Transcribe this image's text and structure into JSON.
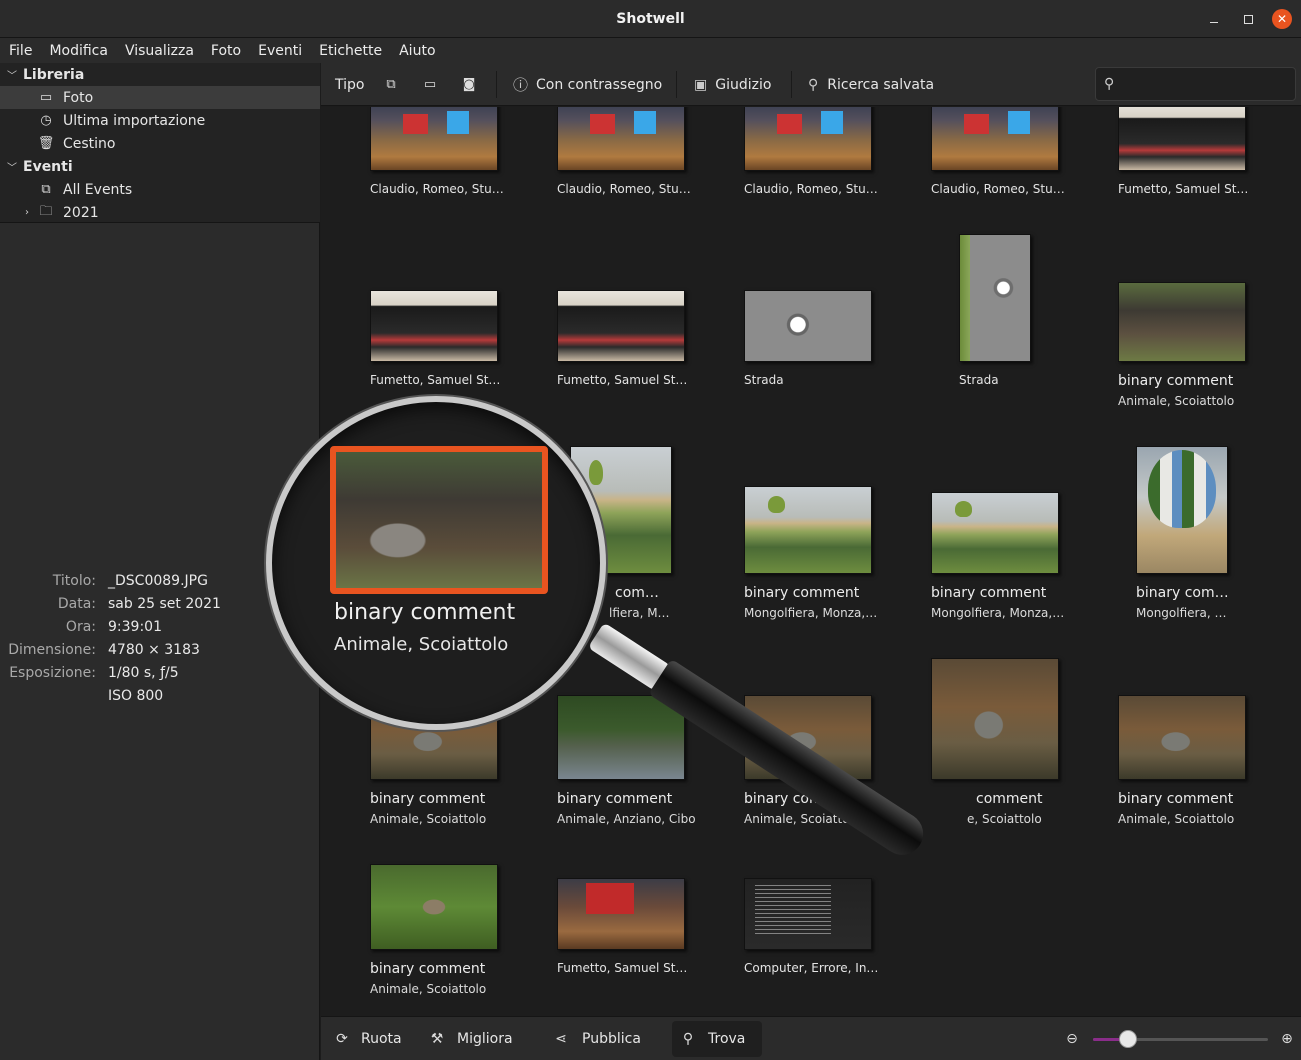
{
  "window": {
    "title": "Shotwell"
  },
  "menu": [
    "File",
    "Modifica",
    "Visualizza",
    "Foto",
    "Eventi",
    "Etichette",
    "Aiuto"
  ],
  "sidebar": {
    "library_label": "Libreria",
    "library_items": [
      {
        "label": "Foto",
        "icon": "photo-icon",
        "selected": true
      },
      {
        "label": "Ultima importazione",
        "icon": "history-icon"
      },
      {
        "label": "Cestino",
        "icon": "trash-icon"
      }
    ],
    "events_label": "Eventi",
    "events_items": [
      {
        "label": "All Events",
        "icon": "events-icon"
      },
      {
        "label": "2021",
        "icon": "folder-icon"
      }
    ]
  },
  "info": {
    "rows": [
      {
        "key": "Titolo:",
        "value": "_DSC0089.JPG"
      },
      {
        "key": "Data:",
        "value": "sab 25 set 2021"
      },
      {
        "key": "Ora:",
        "value": "9:39:01"
      },
      {
        "key": "Dimensione:",
        "value": "4780 × 3183"
      },
      {
        "key": "Esposizione:",
        "value": "1/80 s, ƒ/5"
      },
      {
        "key": "",
        "value": "ISO 800"
      }
    ]
  },
  "toolbar": {
    "type_label": "Tipo",
    "flagged_label": "Con contrassegno",
    "rating_label": "Giudizio",
    "saved_search_label": "Ricerca salvata",
    "search_placeholder": ""
  },
  "photos": [
    {
      "caption": "Claudio, Romeo, Stu…",
      "sub": "",
      "thumb": "office"
    },
    {
      "caption": "Claudio, Romeo, Stu…",
      "sub": "",
      "thumb": "office"
    },
    {
      "caption": "Claudio, Romeo, Stu…",
      "sub": "",
      "thumb": "office"
    },
    {
      "caption": "Claudio, Romeo, Stu…",
      "sub": "",
      "thumb": "office"
    },
    {
      "caption": "Fumetto, Samuel St…",
      "sub": "",
      "thumb": "comics"
    },
    {
      "caption": "Fumetto, Samuel St…",
      "sub": "",
      "thumb": "comics"
    },
    {
      "caption": "Fumetto, Samuel St…",
      "sub": "",
      "thumb": "comics"
    },
    {
      "caption": "Strada",
      "sub": "",
      "thumb": "road"
    },
    {
      "caption": "Strada",
      "sub": "",
      "thumb": "road2"
    },
    {
      "caption": "binary comment",
      "sub": "Animale, Scoiattolo",
      "thumb": "tree"
    },
    {
      "caption": "com…",
      "sub": "lfiera, M…",
      "thumb": "park"
    },
    {
      "caption": "binary comment",
      "sub": "Mongolfiera, Monza,…",
      "thumb": "park"
    },
    {
      "caption": "binary comment",
      "sub": "Mongolfiera, Monza,…",
      "thumb": "park"
    },
    {
      "caption": "binary com…",
      "sub": "Mongolfiera, …",
      "thumb": "balloon"
    },
    {
      "caption": "binary comment",
      "sub": "Animale, Scoiattolo",
      "thumb": "squirrel"
    },
    {
      "caption": "binary comment",
      "sub": "Animale, Anziano, Cibo",
      "thumb": "crowd"
    },
    {
      "caption": "binary commen",
      "sub": "Animale, Scoiattolo",
      "thumb": "squirrel"
    },
    {
      "caption": "comment",
      "sub": "e, Scoiattolo",
      "thumb": "squirrel"
    },
    {
      "caption": "binary comment",
      "sub": "Animale, Scoiattolo",
      "thumb": "squirrel"
    },
    {
      "caption": "binary comment",
      "sub": "Animale, Scoiattolo",
      "thumb": "grass"
    },
    {
      "caption": "Fumetto, Samuel St…",
      "sub": "",
      "thumb": "desk2"
    },
    {
      "caption": "Computer, Errore, In…",
      "sub": "",
      "thumb": "computer"
    }
  ],
  "magnifier": {
    "caption": "binary comment",
    "sub": "Animale, Scoiattolo"
  },
  "bottombar": {
    "rotate_label": "Ruota",
    "enhance_label": "Migliora",
    "publish_label": "Pubblica",
    "find_label": "Trova",
    "zoom_level": 0.2
  },
  "colors": {
    "accent": "#e95420",
    "slider_fill": "#8a2d8a"
  }
}
